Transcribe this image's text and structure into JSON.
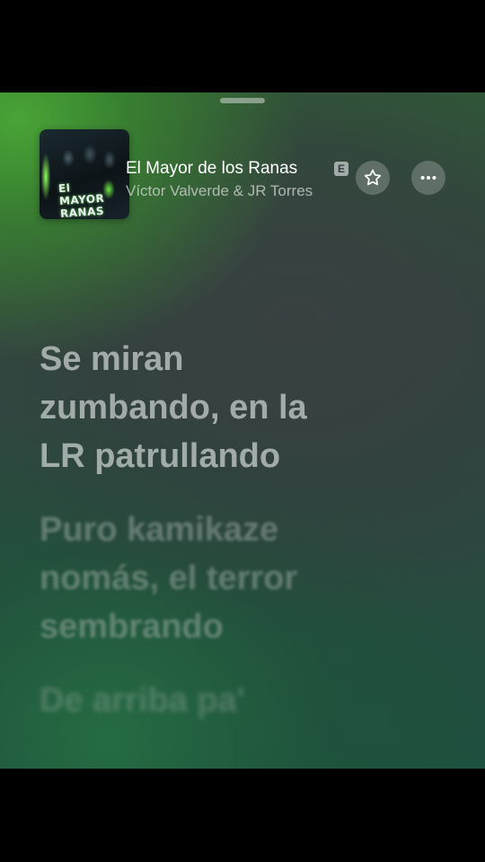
{
  "now_playing": {
    "artwork_text": "El MAYOR\nRANAS",
    "song_title": "El Mayor de los Ranas",
    "explicit_badge": "E",
    "artist": "Víctor Valverde & JR Torres"
  },
  "actions": {
    "favorite_icon": "star-outline-icon",
    "favorite_glyph": "☆",
    "more_icon": "ellipsis-icon",
    "more_glyph": "•••"
  },
  "lyrics": [
    {
      "state": "active",
      "lines": [
        "Se miran",
        "zumbando, en la",
        "LR patrullando"
      ]
    },
    {
      "state": "upcoming",
      "lines": [
        "Puro kamikaze",
        "nomás, el terror",
        "sembrando"
      ]
    },
    {
      "state": "upcoming",
      "lines": [
        "De arriba pa'"
      ]
    }
  ],
  "colors": {
    "background_top": "#4aa836",
    "background_mid": "#3a4042",
    "background_bottom": "#1f5140",
    "title_text": "#ffffff",
    "active_lyric": "#cdd4d2"
  }
}
